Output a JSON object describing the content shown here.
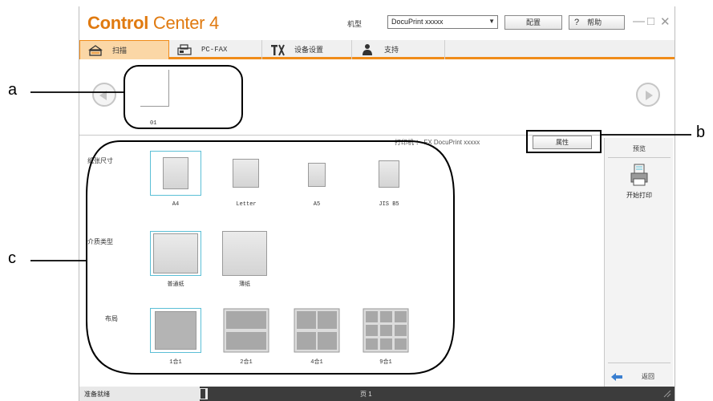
{
  "window": {
    "brand_bold": "Control",
    "brand_rest": " Center 4",
    "model_label": "机型",
    "model_value": "DocuPrint xxxxx",
    "config_button": "配置",
    "help_button": "帮助",
    "help_glyph": "?",
    "win_controls": {
      "minimize": "—",
      "restore": "□",
      "close": "✕"
    }
  },
  "tabs": [
    {
      "label": "扫描",
      "icon": "scan-icon",
      "active": true
    },
    {
      "label": "PC-FAX",
      "icon": "fax-icon",
      "active": false
    },
    {
      "label": "设备设置",
      "icon": "device-settings-icon",
      "active": false
    },
    {
      "label": "支持",
      "icon": "support-icon",
      "active": false
    }
  ],
  "preview": {
    "thumb_label": "01",
    "prev_icon": "prev-arrow-icon",
    "next_icon": "next-arrow-icon"
  },
  "print_panel": {
    "printer_line": "打印机 ： FX DocuPrint xxxxx",
    "properties_button": "属性",
    "preview_label": "预览",
    "start_print_label": "开始打印",
    "back_label": "返回"
  },
  "settings": {
    "paper_size": {
      "label": "纸张尺寸",
      "options": [
        "A4",
        "Letter",
        "A5",
        "JIS B5"
      ],
      "selected": "A4"
    },
    "media_type": {
      "label": "介质类型",
      "options": [
        "普通纸",
        "薄纸"
      ],
      "selected": "普通纸"
    },
    "layout": {
      "label": "布局",
      "options": [
        "1合1",
        "2合1",
        "4合1",
        "9合1"
      ],
      "selected": "1合1"
    }
  },
  "status": {
    "left_text": "准备就绪",
    "page_text": "页 1"
  },
  "callouts": [
    "a",
    "b",
    "c"
  ],
  "colors": {
    "brand": "#e07a10",
    "tab_accent": "#f08c1a",
    "selection": "#5bbfd6"
  }
}
